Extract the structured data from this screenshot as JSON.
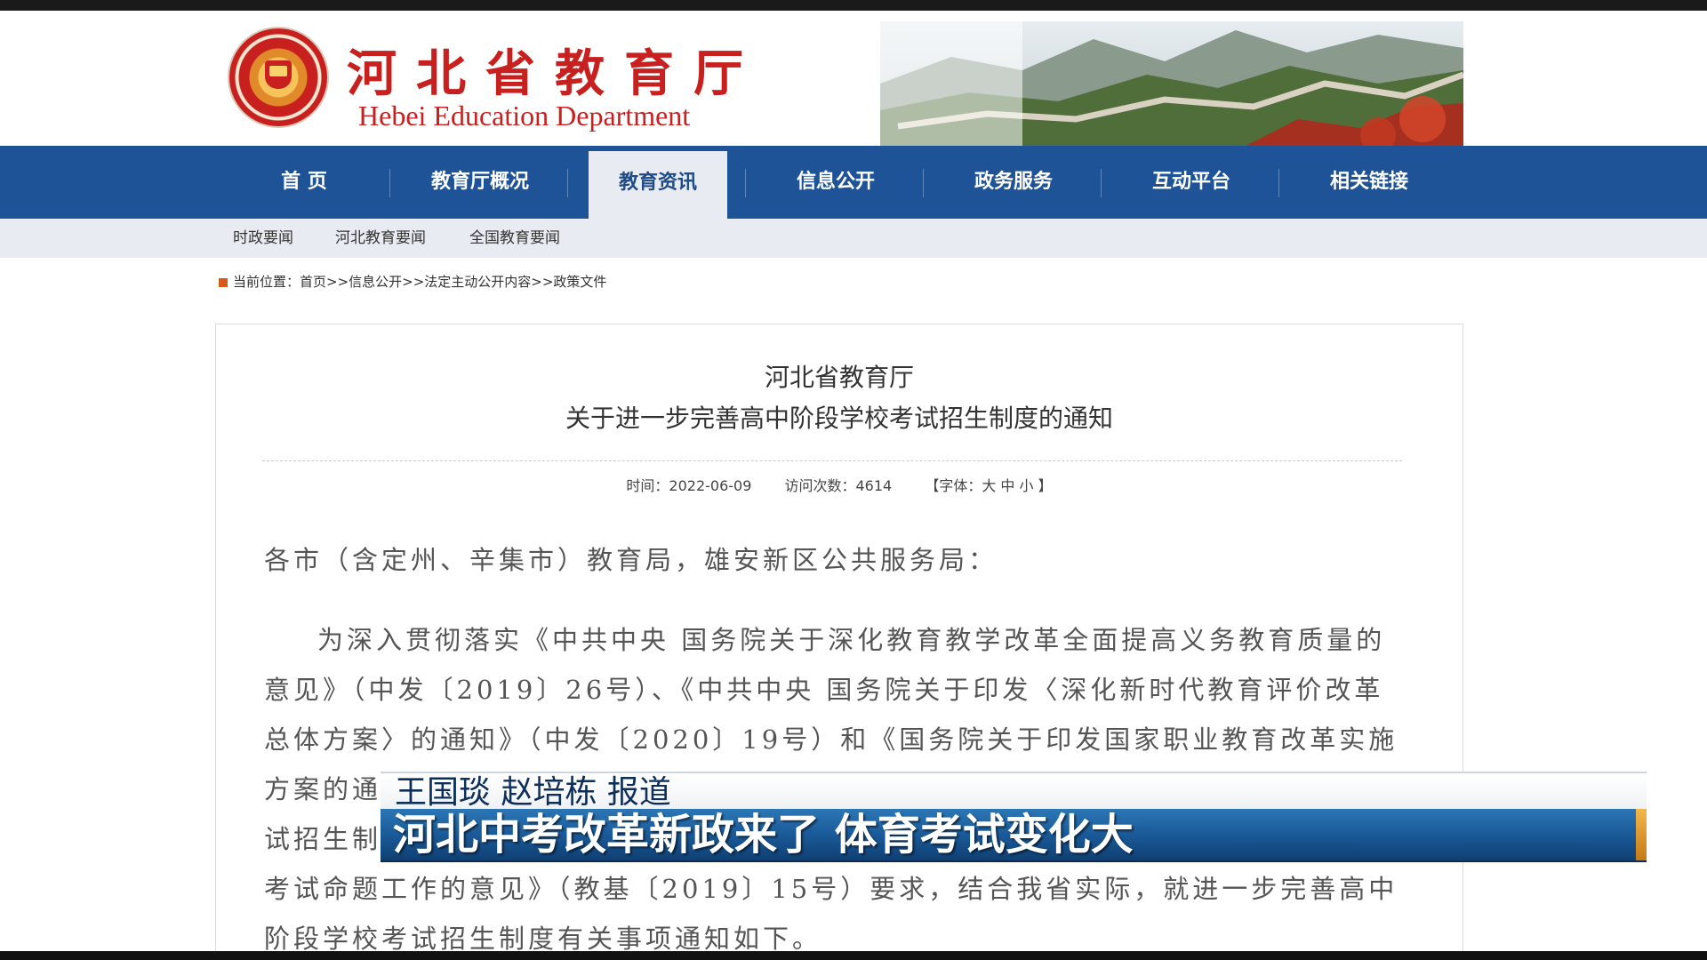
{
  "header": {
    "title_cn": "河北省教育厅",
    "title_en": "Hebei Education Department",
    "logo": "hebei-education-seal"
  },
  "nav": {
    "items": [
      {
        "label": "首 页"
      },
      {
        "label": "教育厅概况"
      },
      {
        "label": "教育资讯"
      },
      {
        "label": "信息公开"
      },
      {
        "label": "政务服务"
      },
      {
        "label": "互动平台"
      },
      {
        "label": "相关链接"
      }
    ],
    "active": "教育资讯"
  },
  "subnav": {
    "items": [
      {
        "label": "时政要闻"
      },
      {
        "label": "河北教育要闻"
      },
      {
        "label": "全国教育要闻"
      }
    ]
  },
  "breadcrumb": {
    "prefix": "当前位置：",
    "path": "首页>>信息公开>>法定主动公开内容>>政策文件"
  },
  "article": {
    "title_line1": "河北省教育厅",
    "title_line2": "关于进一步完善高中阶段学校考试招生制度的通知",
    "time": "时间：2022-06-09",
    "visits": "访问次数：4614",
    "font_size": "【字体：大 中 小 】",
    "lines": [
      "各市（含定州、辛集市）教育局，雄安新区公共服务局：",
      "为深入贯彻落实《中共中央 国务院关于深化教育教学改革全面提高义务教育质量的",
      "意见》（中发〔2019〕26号）、《中共中央 国务院关于印发〈深化新时代教育评价改革",
      "总体方案〉的通知》（中发〔2020〕19号）和《国务院关于印发国家职业教育改革实施",
      "方案的通",
      "试招生制",
      "考试命题工作的意见》（教基〔2019〕15号）要求，结合我省实际，就进一步完善高中",
      "阶段学校考试招生制度有关事项通知如下。"
    ]
  },
  "overlay": {
    "reporters": "王国琰  赵培栋   报道",
    "headline": "河北中考改革新政来了  体育考试变化大",
    "colors": {
      "band": "#1a5a98",
      "accent": "#f2b84a"
    }
  },
  "colors": {
    "nav": "#1f5398",
    "subnav": "#e8ecf2",
    "brand_red": "#c8201f"
  }
}
